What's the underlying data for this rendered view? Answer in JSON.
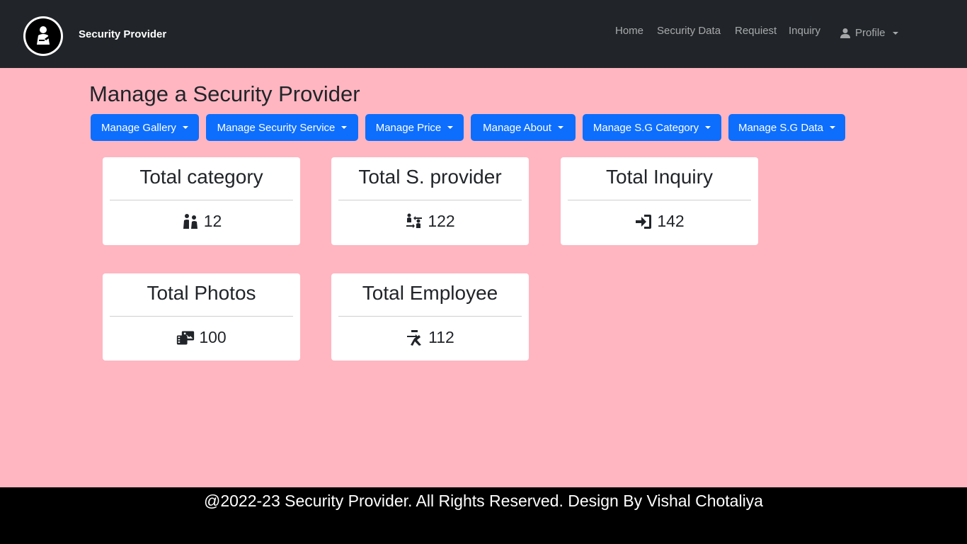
{
  "navbar": {
    "brand_name": "Security Provider",
    "links": {
      "home": "Home",
      "security_data": "Security Data",
      "requiest": "Requiest",
      "inquiry": "Inquiry",
      "profile": "Profile"
    },
    "logo_icon": "security-guard-logo",
    "profile_icon": "user-icon"
  },
  "page": {
    "title": "Manage a Security Provider"
  },
  "menu_buttons": {
    "gallery": "Manage Gallery",
    "service": "Manage Security Service",
    "price": "Manage Price",
    "about": "Manage About",
    "category": "Manage S.G Category",
    "sg_data": "Manage S.G Data"
  },
  "cards": [
    {
      "title": "Total category",
      "value": "12",
      "icon": "people-icon"
    },
    {
      "title": "Total S. provider",
      "value": "122",
      "icon": "people-arrows-icon"
    },
    {
      "title": "Total Inquiry",
      "value": "142",
      "icon": "sign-in-icon"
    },
    {
      "title": "Total Photos",
      "value": "100",
      "icon": "photo-film-icon"
    },
    {
      "title": "Total Employee",
      "value": "112",
      "icon": "person-walking-icon"
    }
  ],
  "footer": {
    "text": "@2022-23 Security Provider. All Rights Reserved. Design By Vishal Chotaliya"
  },
  "colors": {
    "navbar_bg": "#212529",
    "page_bg": "#ffb6c1",
    "button_bg": "#0d6efd",
    "card_bg": "#ffffff",
    "footer_bg": "#000000"
  }
}
